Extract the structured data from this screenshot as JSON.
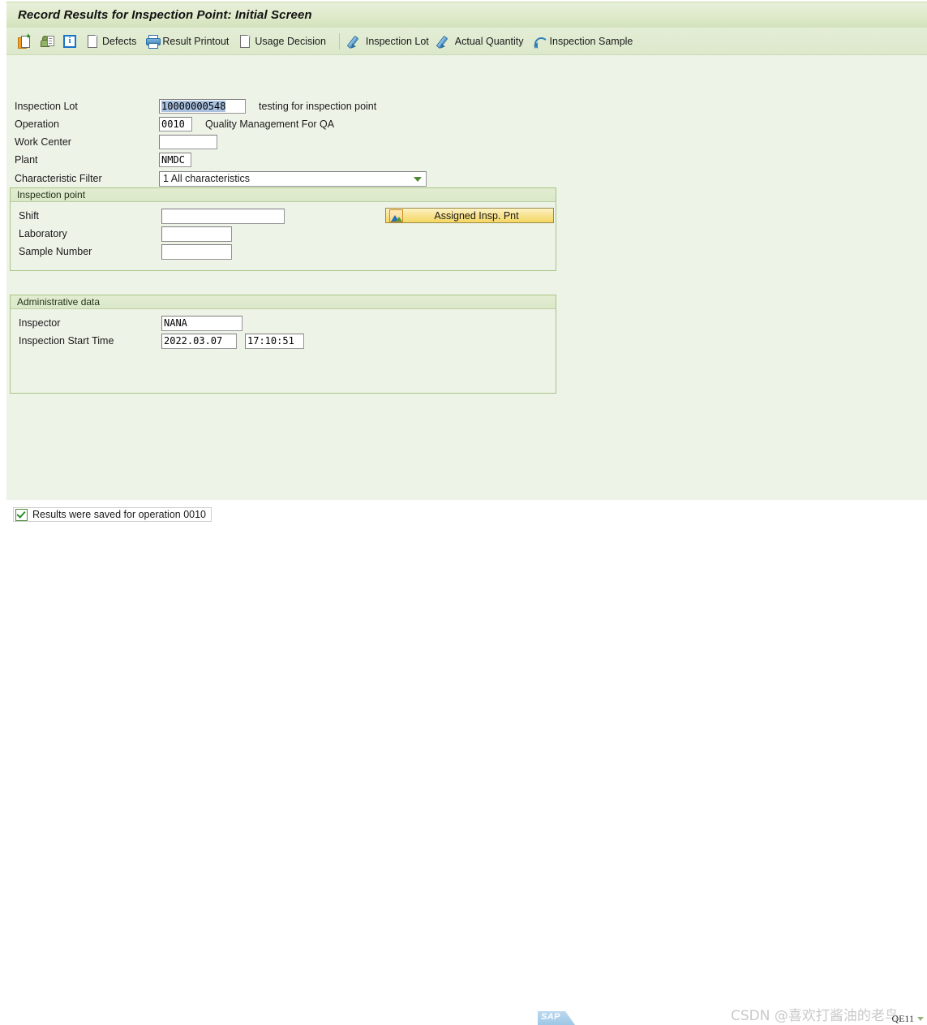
{
  "window": {
    "title": "Record Results for Inspection Point: Initial Screen"
  },
  "toolbar": {
    "items": [
      {
        "icon": "new-document-icon",
        "label": ""
      },
      {
        "icon": "inspector-person-icon",
        "label": ""
      },
      {
        "icon": "info-icon",
        "label": ""
      },
      {
        "icon": "page-icon",
        "label": "Defects"
      },
      {
        "icon": "printer-icon",
        "label": "Result Printout"
      },
      {
        "icon": "page-icon",
        "label": "Usage Decision"
      },
      {
        "icon": "pencil-icon",
        "label": "Inspection Lot"
      },
      {
        "icon": "pencil-icon",
        "label": "Actual Quantity"
      },
      {
        "icon": "undo-icon",
        "label": "Inspection Sample"
      }
    ]
  },
  "form": {
    "inspection_lot": {
      "label": "Inspection Lot",
      "value": "10000000548",
      "description": "testing for inspection point"
    },
    "operation": {
      "label": "Operation",
      "value": "0010",
      "description": "Quality Management For QA"
    },
    "work_center": {
      "label": "Work Center",
      "value": ""
    },
    "plant": {
      "label": "Plant",
      "value": "NMDC"
    },
    "characteristic_filter": {
      "label": "Characteristic Filter",
      "value": "1 All characteristics"
    }
  },
  "inspection_point": {
    "title": "Inspection point",
    "shift": {
      "label": "Shift",
      "value": ""
    },
    "laboratory": {
      "label": "Laboratory",
      "value": ""
    },
    "sample_number": {
      "label": "Sample Number",
      "value": ""
    },
    "assigned_button": {
      "label": "Assigned Insp. Pnt",
      "icon": "mountain-picture-icon"
    }
  },
  "administrative_data": {
    "title": "Administrative data",
    "inspector": {
      "label": "Inspector",
      "value": "NANA"
    },
    "start_time": {
      "label": "Inspection Start Time",
      "date": "2022.03.07",
      "time": "17:10:51"
    }
  },
  "status_bar": {
    "icon": "success-check-icon",
    "message": "Results were saved for operation 0010",
    "logo": "SAP",
    "watermark": "CSDN @喜欢打酱油的老鸟",
    "system": "QE11"
  },
  "colors": {
    "title_bar": "#dfeacb",
    "canvas": "#eef3e8",
    "group_border": "#a8c482",
    "button_gold": "#f8e392",
    "selection_blue": "#a9c0de",
    "accent_green": "#4d8b30"
  }
}
